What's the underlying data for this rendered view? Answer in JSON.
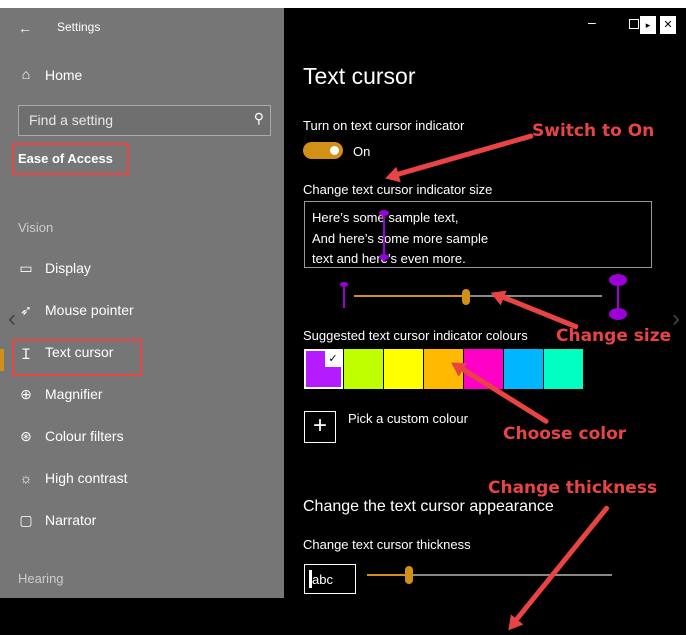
{
  "window": {
    "title": "Settings"
  },
  "sidebar": {
    "home_label": "Home",
    "search_placeholder": "Find a setting",
    "category": "Ease of Access",
    "group_vision": "Vision",
    "items": [
      {
        "label": "Display",
        "icon": "monitor-icon"
      },
      {
        "label": "Mouse pointer",
        "icon": "mouse-pointer-icon"
      },
      {
        "label": "Text cursor",
        "icon": "text-cursor-icon"
      },
      {
        "label": "Magnifier",
        "icon": "magnifier-icon"
      },
      {
        "label": "Colour filters",
        "icon": "colour-filters-icon"
      },
      {
        "label": "High contrast",
        "icon": "high-contrast-icon"
      },
      {
        "label": "Narrator",
        "icon": "narrator-icon"
      }
    ],
    "group_hearing": "Hearing"
  },
  "main": {
    "title": "Text cursor",
    "toggle_label": "Turn on text cursor indicator",
    "toggle_state": "On",
    "size_label": "Change text cursor indicator size",
    "sample_lines": [
      "Here’s some sample text,",
      "And here’s some more sample",
      "text and here’s even more."
    ],
    "size_slider_value": 0.45,
    "colours_label": "Suggested text cursor indicator colours",
    "colours": [
      "#b51bff",
      "#bfff00",
      "#ffff00",
      "#ffb900",
      "#ff00c7",
      "#00b7ff",
      "#00ffc0"
    ],
    "selected_colour_index": 0,
    "custom_colour_label": "Pick a custom colour",
    "appearance_heading": "Change the text cursor appearance",
    "thickness_label": "Change text cursor thickness",
    "thickness_preview": "abc",
    "thickness_slider_value": 0.17
  },
  "annotations": {
    "switch": "Switch to On",
    "size": "Change size",
    "color": "Choose color",
    "thickness": "Change thickness"
  },
  "colors": {
    "accent": "#d39016",
    "highlight_box": "#e84444",
    "indicator": "#9b00d6"
  }
}
